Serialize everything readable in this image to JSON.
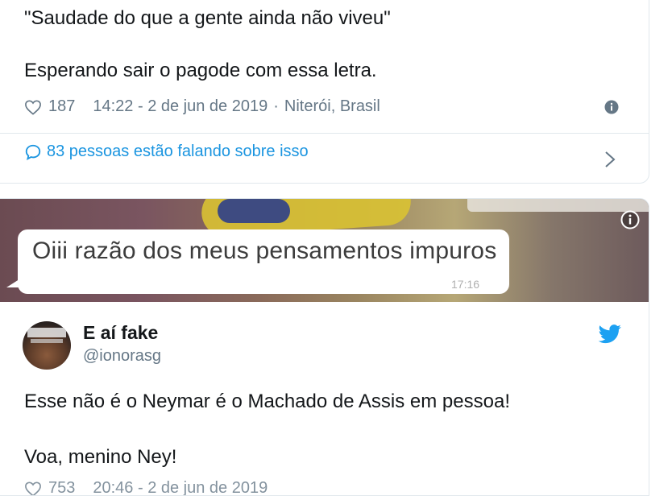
{
  "tweet1": {
    "quote": "\"Saudade do que a gente ainda não viveu\"",
    "body": "Esperando sair o pagode com essa letra.",
    "likes": "187",
    "timestamp": "14:22 - 2 de jun de 2019",
    "separator": "·",
    "location": "Niterói, Brasil",
    "conversation": "83 pessoas estão falando sobre isso"
  },
  "tweet2": {
    "media": {
      "message": "Oiii razão dos meus pensamentos impuros",
      "time": "17:16"
    },
    "display_name": "E aí fake",
    "handle": "@ionorasg",
    "line1": "Esse não é o Neymar é o Machado de Assis em pessoa!",
    "line2": "Voa, menino Ney!",
    "likes": "753",
    "timestamp": "20:46 - 2 de jun de 2019"
  },
  "colors": {
    "text": "#14171a",
    "muted": "#657786",
    "link": "#1b95e0",
    "twitter_blue": "#1da1f2",
    "border": "#e1e8ed"
  },
  "icons": [
    "heart-icon",
    "info-icon",
    "conversation-icon",
    "chevron-right-icon",
    "twitter-bird-icon"
  ]
}
